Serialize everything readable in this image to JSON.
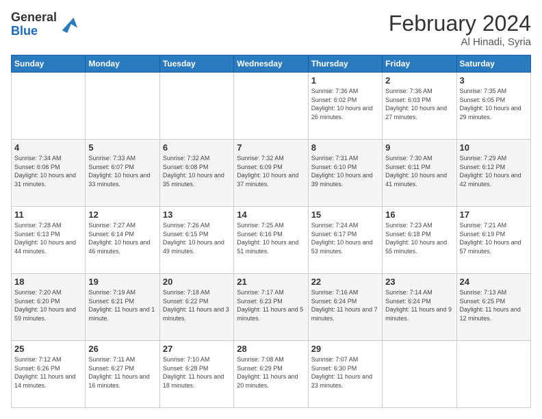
{
  "header": {
    "logo": {
      "line1": "General",
      "line2": "Blue"
    },
    "title": "February 2024",
    "location": "Al Hinadi, Syria"
  },
  "calendar": {
    "days_of_week": [
      "Sunday",
      "Monday",
      "Tuesday",
      "Wednesday",
      "Thursday",
      "Friday",
      "Saturday"
    ],
    "weeks": [
      [
        {
          "day": "",
          "sunrise": "",
          "sunset": "",
          "daylight": ""
        },
        {
          "day": "",
          "sunrise": "",
          "sunset": "",
          "daylight": ""
        },
        {
          "day": "",
          "sunrise": "",
          "sunset": "",
          "daylight": ""
        },
        {
          "day": "",
          "sunrise": "",
          "sunset": "",
          "daylight": ""
        },
        {
          "day": "1",
          "sunrise": "7:36 AM",
          "sunset": "6:02 PM",
          "daylight": "10 hours and 26 minutes."
        },
        {
          "day": "2",
          "sunrise": "7:36 AM",
          "sunset": "6:03 PM",
          "daylight": "10 hours and 27 minutes."
        },
        {
          "day": "3",
          "sunrise": "7:35 AM",
          "sunset": "6:05 PM",
          "daylight": "10 hours and 29 minutes."
        }
      ],
      [
        {
          "day": "4",
          "sunrise": "7:34 AM",
          "sunset": "6:06 PM",
          "daylight": "10 hours and 31 minutes."
        },
        {
          "day": "5",
          "sunrise": "7:33 AM",
          "sunset": "6:07 PM",
          "daylight": "10 hours and 33 minutes."
        },
        {
          "day": "6",
          "sunrise": "7:32 AM",
          "sunset": "6:08 PM",
          "daylight": "10 hours and 35 minutes."
        },
        {
          "day": "7",
          "sunrise": "7:32 AM",
          "sunset": "6:09 PM",
          "daylight": "10 hours and 37 minutes."
        },
        {
          "day": "8",
          "sunrise": "7:31 AM",
          "sunset": "6:10 PM",
          "daylight": "10 hours and 39 minutes."
        },
        {
          "day": "9",
          "sunrise": "7:30 AM",
          "sunset": "6:11 PM",
          "daylight": "10 hours and 41 minutes."
        },
        {
          "day": "10",
          "sunrise": "7:29 AM",
          "sunset": "6:12 PM",
          "daylight": "10 hours and 42 minutes."
        }
      ],
      [
        {
          "day": "11",
          "sunrise": "7:28 AM",
          "sunset": "6:13 PM",
          "daylight": "10 hours and 44 minutes."
        },
        {
          "day": "12",
          "sunrise": "7:27 AM",
          "sunset": "6:14 PM",
          "daylight": "10 hours and 46 minutes."
        },
        {
          "day": "13",
          "sunrise": "7:26 AM",
          "sunset": "6:15 PM",
          "daylight": "10 hours and 49 minutes."
        },
        {
          "day": "14",
          "sunrise": "7:25 AM",
          "sunset": "6:16 PM",
          "daylight": "10 hours and 51 minutes."
        },
        {
          "day": "15",
          "sunrise": "7:24 AM",
          "sunset": "6:17 PM",
          "daylight": "10 hours and 53 minutes."
        },
        {
          "day": "16",
          "sunrise": "7:23 AM",
          "sunset": "6:18 PM",
          "daylight": "10 hours and 55 minutes."
        },
        {
          "day": "17",
          "sunrise": "7:21 AM",
          "sunset": "6:19 PM",
          "daylight": "10 hours and 57 minutes."
        }
      ],
      [
        {
          "day": "18",
          "sunrise": "7:20 AM",
          "sunset": "6:20 PM",
          "daylight": "10 hours and 59 minutes."
        },
        {
          "day": "19",
          "sunrise": "7:19 AM",
          "sunset": "6:21 PM",
          "daylight": "11 hours and 1 minute."
        },
        {
          "day": "20",
          "sunrise": "7:18 AM",
          "sunset": "6:22 PM",
          "daylight": "11 hours and 3 minutes."
        },
        {
          "day": "21",
          "sunrise": "7:17 AM",
          "sunset": "6:23 PM",
          "daylight": "11 hours and 5 minutes."
        },
        {
          "day": "22",
          "sunrise": "7:16 AM",
          "sunset": "6:24 PM",
          "daylight": "11 hours and 7 minutes."
        },
        {
          "day": "23",
          "sunrise": "7:14 AM",
          "sunset": "6:24 PM",
          "daylight": "11 hours and 9 minutes."
        },
        {
          "day": "24",
          "sunrise": "7:13 AM",
          "sunset": "6:25 PM",
          "daylight": "11 hours and 12 minutes."
        }
      ],
      [
        {
          "day": "25",
          "sunrise": "7:12 AM",
          "sunset": "6:26 PM",
          "daylight": "11 hours and 14 minutes."
        },
        {
          "day": "26",
          "sunrise": "7:11 AM",
          "sunset": "6:27 PM",
          "daylight": "11 hours and 16 minutes."
        },
        {
          "day": "27",
          "sunrise": "7:10 AM",
          "sunset": "6:28 PM",
          "daylight": "11 hours and 18 minutes."
        },
        {
          "day": "28",
          "sunrise": "7:08 AM",
          "sunset": "6:29 PM",
          "daylight": "11 hours and 20 minutes."
        },
        {
          "day": "29",
          "sunrise": "7:07 AM",
          "sunset": "6:30 PM",
          "daylight": "11 hours and 23 minutes."
        },
        {
          "day": "",
          "sunrise": "",
          "sunset": "",
          "daylight": ""
        },
        {
          "day": "",
          "sunrise": "",
          "sunset": "",
          "daylight": ""
        }
      ]
    ]
  }
}
